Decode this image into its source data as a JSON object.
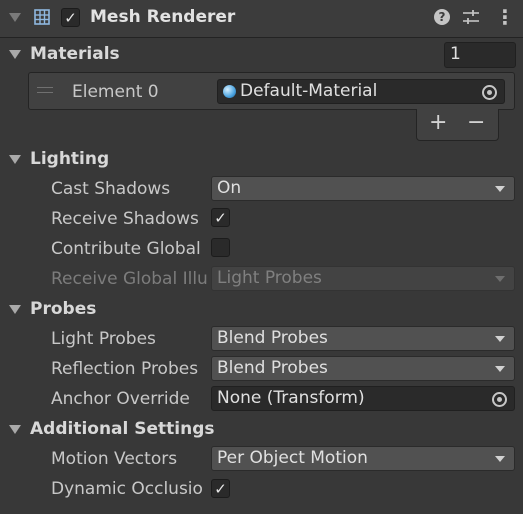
{
  "component": {
    "title": "Mesh Renderer",
    "icons": [
      "help-icon",
      "presets-icon",
      "more-options-icon"
    ]
  },
  "materials": {
    "title": "Materials",
    "size": "1",
    "element_label": "Element 0",
    "element_value": "Default-Material",
    "add_label": "+",
    "remove_label": "−"
  },
  "lighting": {
    "title": "Lighting",
    "cast_shadows_label": "Cast Shadows",
    "cast_shadows_value": "On",
    "receive_shadows_label": "Receive Shadows",
    "receive_shadows_checked": true,
    "contribute_gi_label": "Contribute Global",
    "contribute_gi_checked": false,
    "receive_gi_label": "Receive Global Illu",
    "receive_gi_value": "Light Probes"
  },
  "probes": {
    "title": "Probes",
    "light_probes_label": "Light Probes",
    "light_probes_value": "Blend Probes",
    "reflection_probes_label": "Reflection Probes",
    "reflection_probes_value": "Blend Probes",
    "anchor_override_label": "Anchor Override",
    "anchor_override_value": "None (Transform)"
  },
  "additional": {
    "title": "Additional Settings",
    "motion_vectors_label": "Motion Vectors",
    "motion_vectors_value": "Per Object Motion",
    "dynamic_occlusion_label": "Dynamic Occlusio",
    "dynamic_occlusion_checked": true
  },
  "glyphs": {
    "check": "✓",
    "help": "?",
    "more": "⋮"
  },
  "colors": {
    "background": "#383838",
    "field": "#515151",
    "object_field": "#2a2a2a",
    "text": "#d2d2d2"
  }
}
